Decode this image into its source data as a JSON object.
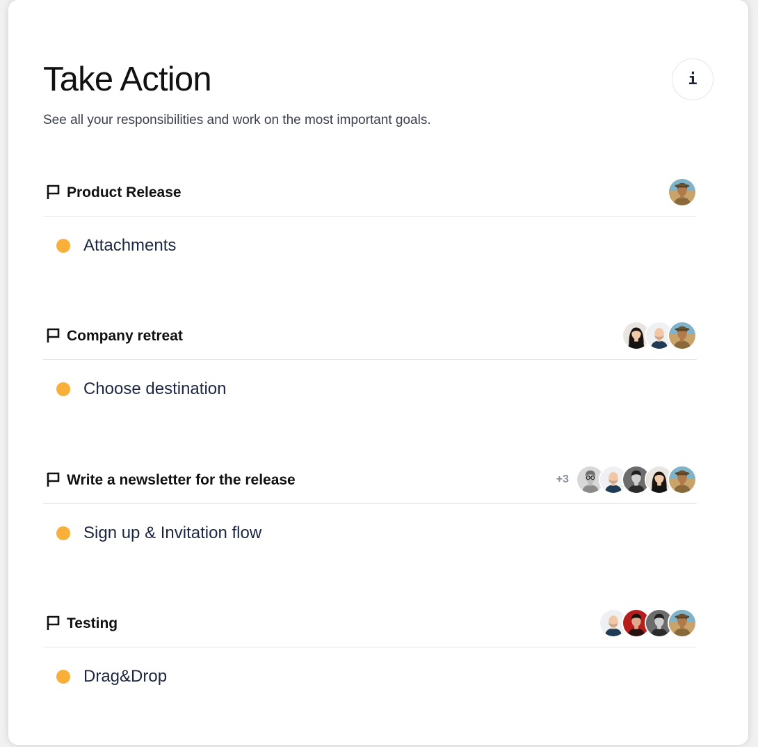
{
  "page": {
    "title": "Take Action",
    "subtitle": "See all your responsibilities and work on the most important goals.",
    "info_button": {
      "label": "i",
      "icon": "info-icon"
    }
  },
  "colors": {
    "status_dot": "#f9b03a",
    "title_text": "#111111",
    "task_text": "#1c2640"
  },
  "projects": [
    {
      "title": "Product Release",
      "icon": "flag-icon",
      "members": [
        "explorer"
      ],
      "extra_members": "",
      "task": {
        "label": "Attachments",
        "status": "in-progress"
      }
    },
    {
      "title": "Company retreat",
      "icon": "flag-icon",
      "members": [
        "woman-dark-hair",
        "bald-man",
        "explorer"
      ],
      "extra_members": "",
      "task": {
        "label": "Choose destination",
        "status": "in-progress"
      }
    },
    {
      "title": "Write a newsletter for the release",
      "icon": "flag-icon",
      "members": [
        "man-glasses-grey",
        "bald-man",
        "man-bw",
        "woman-dark-hair",
        "explorer"
      ],
      "extra_members": "+3",
      "task": {
        "label": "Sign up & Invitation flow",
        "status": "in-progress"
      }
    },
    {
      "title": "Testing",
      "icon": "flag-icon",
      "members": [
        "bald-man",
        "man-red",
        "man-bw",
        "explorer"
      ],
      "extra_members": "",
      "task": {
        "label": "Drag&Drop",
        "status": "in-progress"
      }
    }
  ]
}
